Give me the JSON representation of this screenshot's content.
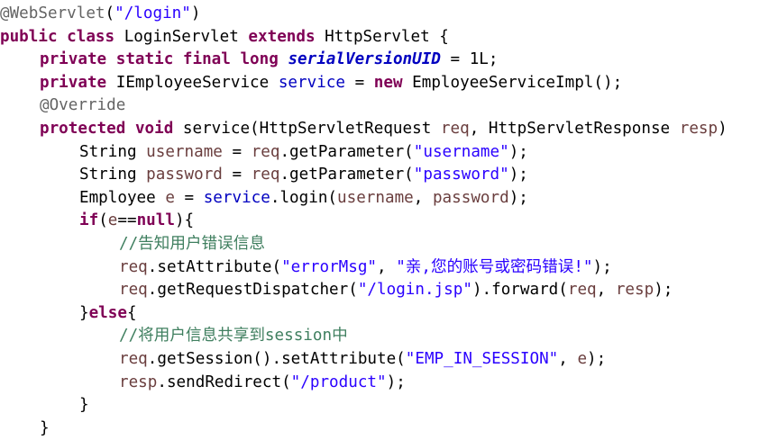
{
  "editor": {
    "language": "java",
    "colors": {
      "keyword": "#7f0055",
      "annotation": "#646464",
      "field": "#0000c0",
      "local_variable": "#6a3e3e",
      "string": "#2a00ff",
      "comment": "#3f7f5f",
      "plain": "#000000",
      "background": "#ffffff"
    },
    "lines": [
      {
        "indent": 0,
        "tokens": [
          [
            "anno",
            "@WebServlet"
          ],
          [
            "plain",
            "("
          ],
          [
            "str",
            "\"/login\""
          ],
          [
            "plain",
            ")"
          ]
        ]
      },
      {
        "indent": 0,
        "tokens": [
          [
            "kw",
            "public"
          ],
          [
            "plain",
            " "
          ],
          [
            "kw",
            "class"
          ],
          [
            "plain",
            " LoginServlet "
          ],
          [
            "kw",
            "extends"
          ],
          [
            "plain",
            " HttpServlet {"
          ]
        ]
      },
      {
        "indent": 1,
        "tokens": [
          [
            "kw",
            "private"
          ],
          [
            "plain",
            " "
          ],
          [
            "kw",
            "static"
          ],
          [
            "plain",
            " "
          ],
          [
            "kw",
            "final"
          ],
          [
            "plain",
            " "
          ],
          [
            "kw",
            "long"
          ],
          [
            "plain",
            " "
          ],
          [
            "static-field",
            "serialVersionUID"
          ],
          [
            "plain",
            " = 1L;"
          ]
        ]
      },
      {
        "indent": 1,
        "tokens": [
          [
            "kw",
            "private"
          ],
          [
            "plain",
            " IEmployeeService "
          ],
          [
            "field",
            "service"
          ],
          [
            "plain",
            " = "
          ],
          [
            "kw",
            "new"
          ],
          [
            "plain",
            " EmployeeServiceImpl();"
          ]
        ]
      },
      {
        "indent": 1,
        "tokens": [
          [
            "anno",
            "@Override"
          ]
        ]
      },
      {
        "indent": 1,
        "tokens": [
          [
            "kw",
            "protected"
          ],
          [
            "plain",
            " "
          ],
          [
            "kw",
            "void"
          ],
          [
            "plain",
            " service(HttpServletRequest "
          ],
          [
            "var",
            "req"
          ],
          [
            "plain",
            ", HttpServletResponse "
          ],
          [
            "var",
            "resp"
          ],
          [
            "plain",
            ")"
          ]
        ]
      },
      {
        "indent": 2,
        "tokens": [
          [
            "plain",
            "String "
          ],
          [
            "var",
            "username"
          ],
          [
            "plain",
            " = "
          ],
          [
            "var",
            "req"
          ],
          [
            "plain",
            ".getParameter("
          ],
          [
            "str",
            "\"username\""
          ],
          [
            "plain",
            ");"
          ]
        ]
      },
      {
        "indent": 2,
        "tokens": [
          [
            "plain",
            "String "
          ],
          [
            "var",
            "password"
          ],
          [
            "plain",
            " = "
          ],
          [
            "var",
            "req"
          ],
          [
            "plain",
            ".getParameter("
          ],
          [
            "str",
            "\"password\""
          ],
          [
            "plain",
            ");"
          ]
        ]
      },
      {
        "indent": 2,
        "tokens": [
          [
            "plain",
            "Employee "
          ],
          [
            "var",
            "e"
          ],
          [
            "plain",
            " = "
          ],
          [
            "field",
            "service"
          ],
          [
            "plain",
            ".login("
          ],
          [
            "var",
            "username"
          ],
          [
            "plain",
            ", "
          ],
          [
            "var",
            "password"
          ],
          [
            "plain",
            ");"
          ]
        ]
      },
      {
        "indent": 2,
        "tokens": [
          [
            "kw",
            "if"
          ],
          [
            "plain",
            "("
          ],
          [
            "var",
            "e"
          ],
          [
            "plain",
            "=="
          ],
          [
            "kw",
            "null"
          ],
          [
            "plain",
            "){"
          ]
        ]
      },
      {
        "indent": 3,
        "tokens": [
          [
            "comment",
            "//告知用户错误信息"
          ]
        ]
      },
      {
        "indent": 3,
        "tokens": [
          [
            "var",
            "req"
          ],
          [
            "plain",
            ".setAttribute("
          ],
          [
            "str",
            "\"errorMsg\""
          ],
          [
            "plain",
            ", "
          ],
          [
            "str",
            "\"亲,您的账号或密码错误!\""
          ],
          [
            "plain",
            ");"
          ]
        ]
      },
      {
        "indent": 3,
        "tokens": [
          [
            "var",
            "req"
          ],
          [
            "plain",
            ".getRequestDispatcher("
          ],
          [
            "str",
            "\"/login.jsp\""
          ],
          [
            "plain",
            ").forward("
          ],
          [
            "var",
            "req"
          ],
          [
            "plain",
            ", "
          ],
          [
            "var",
            "resp"
          ],
          [
            "plain",
            ");"
          ]
        ]
      },
      {
        "indent": 2,
        "tokens": [
          [
            "plain",
            "}"
          ],
          [
            "kw",
            "else"
          ],
          [
            "plain",
            "{"
          ]
        ]
      },
      {
        "indent": 3,
        "tokens": [
          [
            "comment",
            "//将用户信息共享到session中"
          ]
        ]
      },
      {
        "indent": 3,
        "tokens": [
          [
            "var",
            "req"
          ],
          [
            "plain",
            ".getSession().setAttribute("
          ],
          [
            "str",
            "\"EMP_IN_SESSION\""
          ],
          [
            "plain",
            ", "
          ],
          [
            "var",
            "e"
          ],
          [
            "plain",
            ");"
          ]
        ]
      },
      {
        "indent": 3,
        "tokens": [
          [
            "var",
            "resp"
          ],
          [
            "plain",
            ".sendRedirect("
          ],
          [
            "str",
            "\"/product\""
          ],
          [
            "plain",
            ");"
          ]
        ]
      },
      {
        "indent": 2,
        "tokens": [
          [
            "plain",
            "}"
          ]
        ]
      },
      {
        "indent": 1,
        "tokens": [
          [
            "plain",
            "}"
          ]
        ]
      }
    ]
  }
}
